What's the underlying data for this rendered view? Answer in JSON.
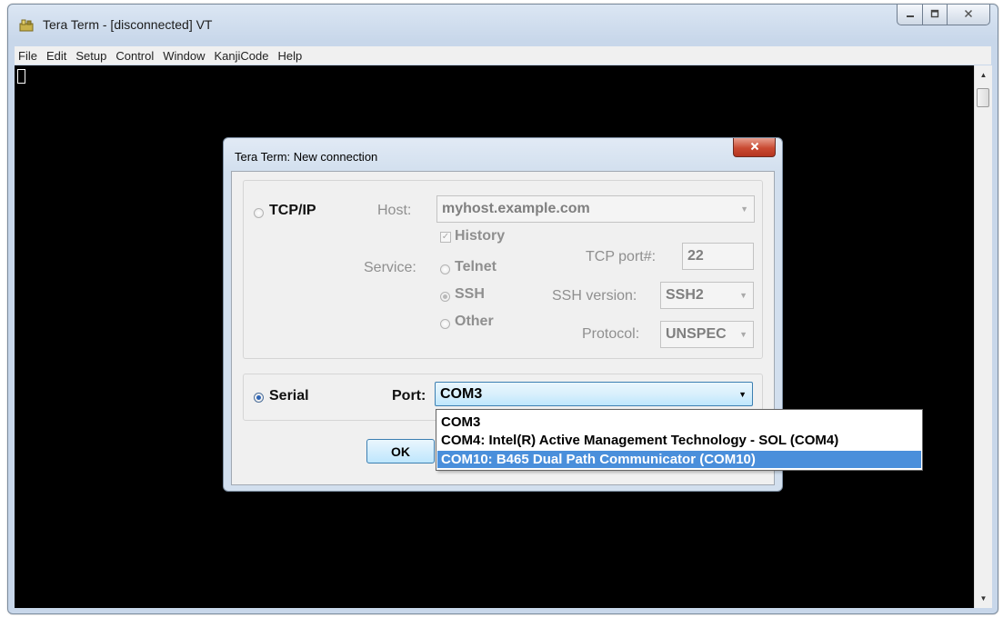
{
  "window": {
    "title": "Tera Term - [disconnected] VT"
  },
  "menubar": {
    "items": [
      "File",
      "Edit",
      "Setup",
      "Control",
      "Window",
      "KanjiCode",
      "Help"
    ]
  },
  "dialog": {
    "title": "Tera Term: New connection",
    "close_label": "x",
    "tcpip": {
      "radio_label": "TCP/IP",
      "host_label": "Host:",
      "host_value": "myhost.example.com",
      "history_label": "History",
      "history_checked": true,
      "service_label": "Service:",
      "services": [
        "Telnet",
        "SSH",
        "Other"
      ],
      "selected_service": "SSH",
      "tcp_port_label": "TCP port#:",
      "tcp_port_value": "22",
      "ssh_version_label": "SSH version:",
      "ssh_version_value": "SSH2",
      "protocol_label": "Protocol:",
      "protocol_value": "UNSPEC"
    },
    "serial": {
      "radio_label": "Serial",
      "selected": true,
      "port_label": "Port:",
      "port_value": "COM3",
      "port_options": [
        "COM3",
        "COM4: Intel(R) Active Management Technology - SOL (COM4)",
        "COM10: B465 Dual Path Communicator (COM10)"
      ],
      "highlighted_option": "COM10: B465 Dual Path Communicator (COM10)"
    },
    "ok_label": "OK"
  },
  "icons": {
    "app": "tera-term-icon",
    "minimize": "minimize-icon",
    "maximize": "maximize-icon",
    "close": "close-icon",
    "dropdown": "chevron-down-icon"
  }
}
